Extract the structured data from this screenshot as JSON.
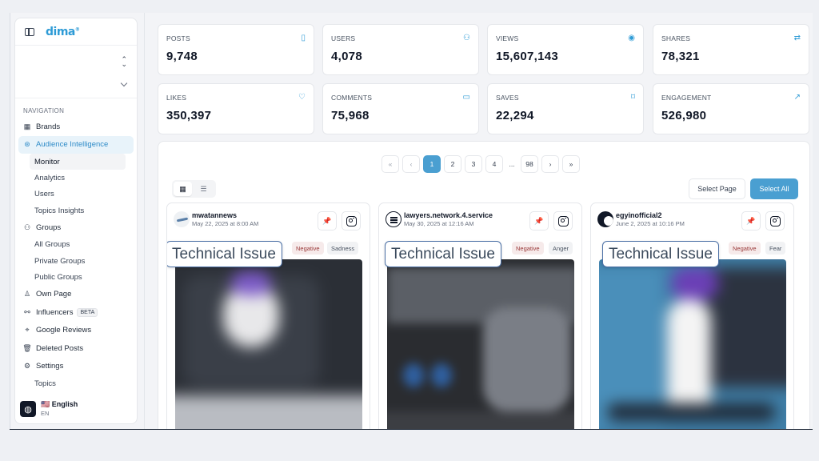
{
  "sidebar": {
    "logo": "dima",
    "logo_mark": "®",
    "nav_heading": "NAVIGATION",
    "items": [
      {
        "label": "Brands",
        "icon": "grid-icon"
      },
      {
        "label": "Audience Intelligence",
        "icon": "audience-icon",
        "active": true
      },
      {
        "label": "Monitor",
        "sub": true,
        "selected": true
      },
      {
        "label": "Analytics",
        "sub": true
      },
      {
        "label": "Users",
        "sub": true
      },
      {
        "label": "Topics Insights",
        "sub": true
      },
      {
        "label": "Groups",
        "icon": "groups-icon"
      },
      {
        "label": "All Groups",
        "sub": true
      },
      {
        "label": "Private Groups",
        "sub": true
      },
      {
        "label": "Public Groups",
        "sub": true
      },
      {
        "label": "Own Page",
        "icon": "user-icon"
      },
      {
        "label": "Influencers",
        "icon": "influencers-icon",
        "badge": "BETA"
      },
      {
        "label": "Google Reviews",
        "icon": "location-icon"
      },
      {
        "label": "Deleted Posts",
        "icon": "trash-icon"
      },
      {
        "label": "Settings",
        "icon": "gear-icon"
      },
      {
        "label": "Topics",
        "sub": true
      }
    ],
    "language": {
      "flag": "🇺🇸",
      "name": "English",
      "code": "EN"
    }
  },
  "stats": [
    {
      "label": "POSTS",
      "value": "9,748",
      "icon": "phone-icon"
    },
    {
      "label": "USERS",
      "value": "4,078",
      "icon": "users-icon"
    },
    {
      "label": "VIEWS",
      "value": "15,607,143",
      "icon": "eye-icon"
    },
    {
      "label": "SHARES",
      "value": "78,321",
      "icon": "repeat-icon"
    },
    {
      "label": "LIKES",
      "value": "350,397",
      "icon": "heart-icon"
    },
    {
      "label": "COMMENTS",
      "value": "75,968",
      "icon": "comment-icon"
    },
    {
      "label": "SAVES",
      "value": "22,294",
      "icon": "bookmark-icon"
    },
    {
      "label": "ENGAGEMENT",
      "value": "526,980",
      "icon": "trending-icon"
    }
  ],
  "pagination": {
    "first": "«",
    "prev": "‹",
    "next": "›",
    "last": "»",
    "pages": [
      "1",
      "2",
      "3",
      "4"
    ],
    "ellipsis": "...",
    "last_page": "98",
    "current": "1"
  },
  "toolbar": {
    "select_page": "Select Page",
    "select_all": "Select All"
  },
  "posts": [
    {
      "user": "mwatannews",
      "date": "May 22, 2025 at 8:00 AM",
      "sentiment": "Negative",
      "emotion": "Sadness",
      "topic": "Technical Issue"
    },
    {
      "user": "lawyers.network.4.service",
      "date": "May 30, 2025 at 12:16 AM",
      "sentiment": "Negative",
      "emotion": "Anger",
      "topic": "Technical Issue"
    },
    {
      "user": "egyinofficial2",
      "date": "June 2, 2025 at 10:16 PM",
      "sentiment": "Negative",
      "emotion": "Fear",
      "topic": "Technical Issue"
    }
  ],
  "colors": {
    "accent": "#4a9fd1",
    "negative_bg": "#f6eaea",
    "negative_text": "#9b3b3b"
  }
}
